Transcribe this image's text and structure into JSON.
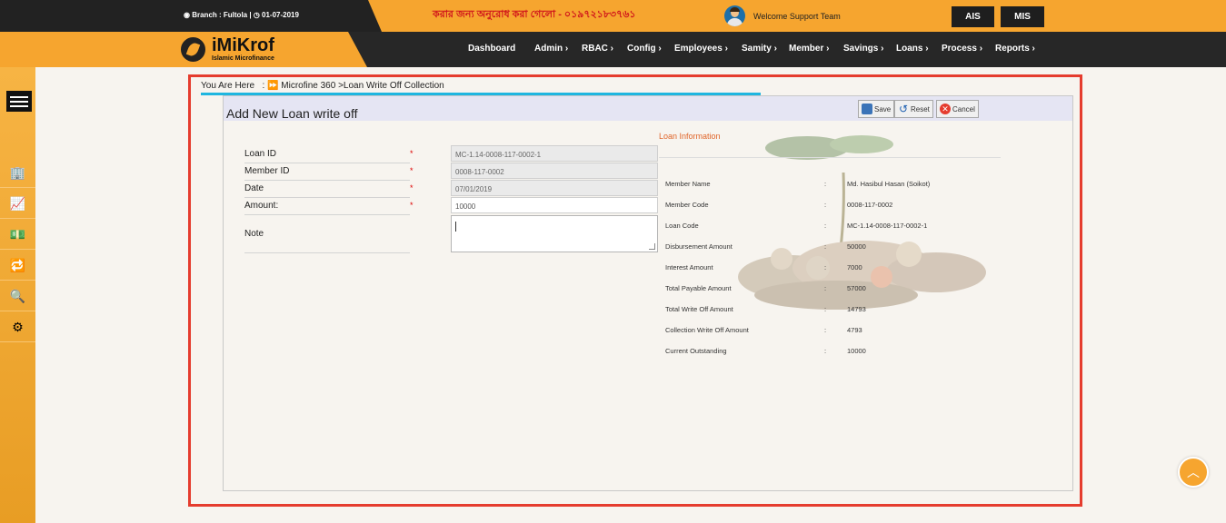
{
  "topbar": {
    "branch": "Branch : Fultola |",
    "date": "01-07-2019",
    "marquee": "করার জন্য অনুরোধ করা গেলো - ০১৯৭২১৮৩৭৬১",
    "welcome": "Welcome Support Team",
    "buttons": [
      "AIS",
      "MIS"
    ]
  },
  "logo": {
    "name": "iMiKrof",
    "tagline": "Islamic Microfinance"
  },
  "nav": [
    "Dashboard",
    "Admin ›",
    "RBAC ›",
    "Config ›",
    "Employees ›",
    "Samity ›",
    "Member ›",
    "Savings ›",
    "Loans ›",
    "Process ›",
    "Reports ›"
  ],
  "sidebar": {
    "icons": [
      "building-icon",
      "chart-icon",
      "cash-icon",
      "transfer-icon",
      "search-report-icon",
      "settings-icon"
    ]
  },
  "breadcrumb": {
    "prefix": "You Are Here",
    "path": "Microfine 360 >Loan Write Off Collection"
  },
  "form": {
    "title": "Add New Loan write off",
    "buttons": {
      "save": "Save",
      "reset": "Reset",
      "cancel": "Cancel"
    },
    "fields": {
      "loan_id": {
        "label": "Loan ID",
        "value": "MC-1.14-0008-117-0002-1"
      },
      "member_id": {
        "label": "Member ID",
        "value": "0008-117-0002"
      },
      "date": {
        "label": "Date",
        "value": "07/01/2019"
      },
      "amount": {
        "label": "Amount:",
        "value": "10000"
      },
      "note": {
        "label": "Note",
        "value": ""
      }
    },
    "required_mark": "*"
  },
  "loan_info": {
    "title": "Loan Information",
    "separator": ":",
    "rows": [
      {
        "label": "Member Name",
        "value": "Md. Hasibul Hasan (Soikot)"
      },
      {
        "label": "Member Code",
        "value": "0008-117-0002"
      },
      {
        "label": "Loan Code",
        "value": "MC-1.14-0008-117-0002-1"
      },
      {
        "label": "Disbursement Amount",
        "value": "50000"
      },
      {
        "label": "Interest Amount",
        "value": "7000"
      },
      {
        "label": "Total Payable Amount",
        "value": "57000"
      },
      {
        "label": "Total Write Off Amount",
        "value": "14793"
      },
      {
        "label": "Collection Write Off Amount",
        "value": "4793"
      },
      {
        "label": "Current Outstanding",
        "value": "10000"
      }
    ]
  },
  "colors": {
    "accent": "#f6a52f",
    "dark": "#272727",
    "highlight_frame": "#e53c2e",
    "breadcrumb_line": "#1fb6e0"
  }
}
